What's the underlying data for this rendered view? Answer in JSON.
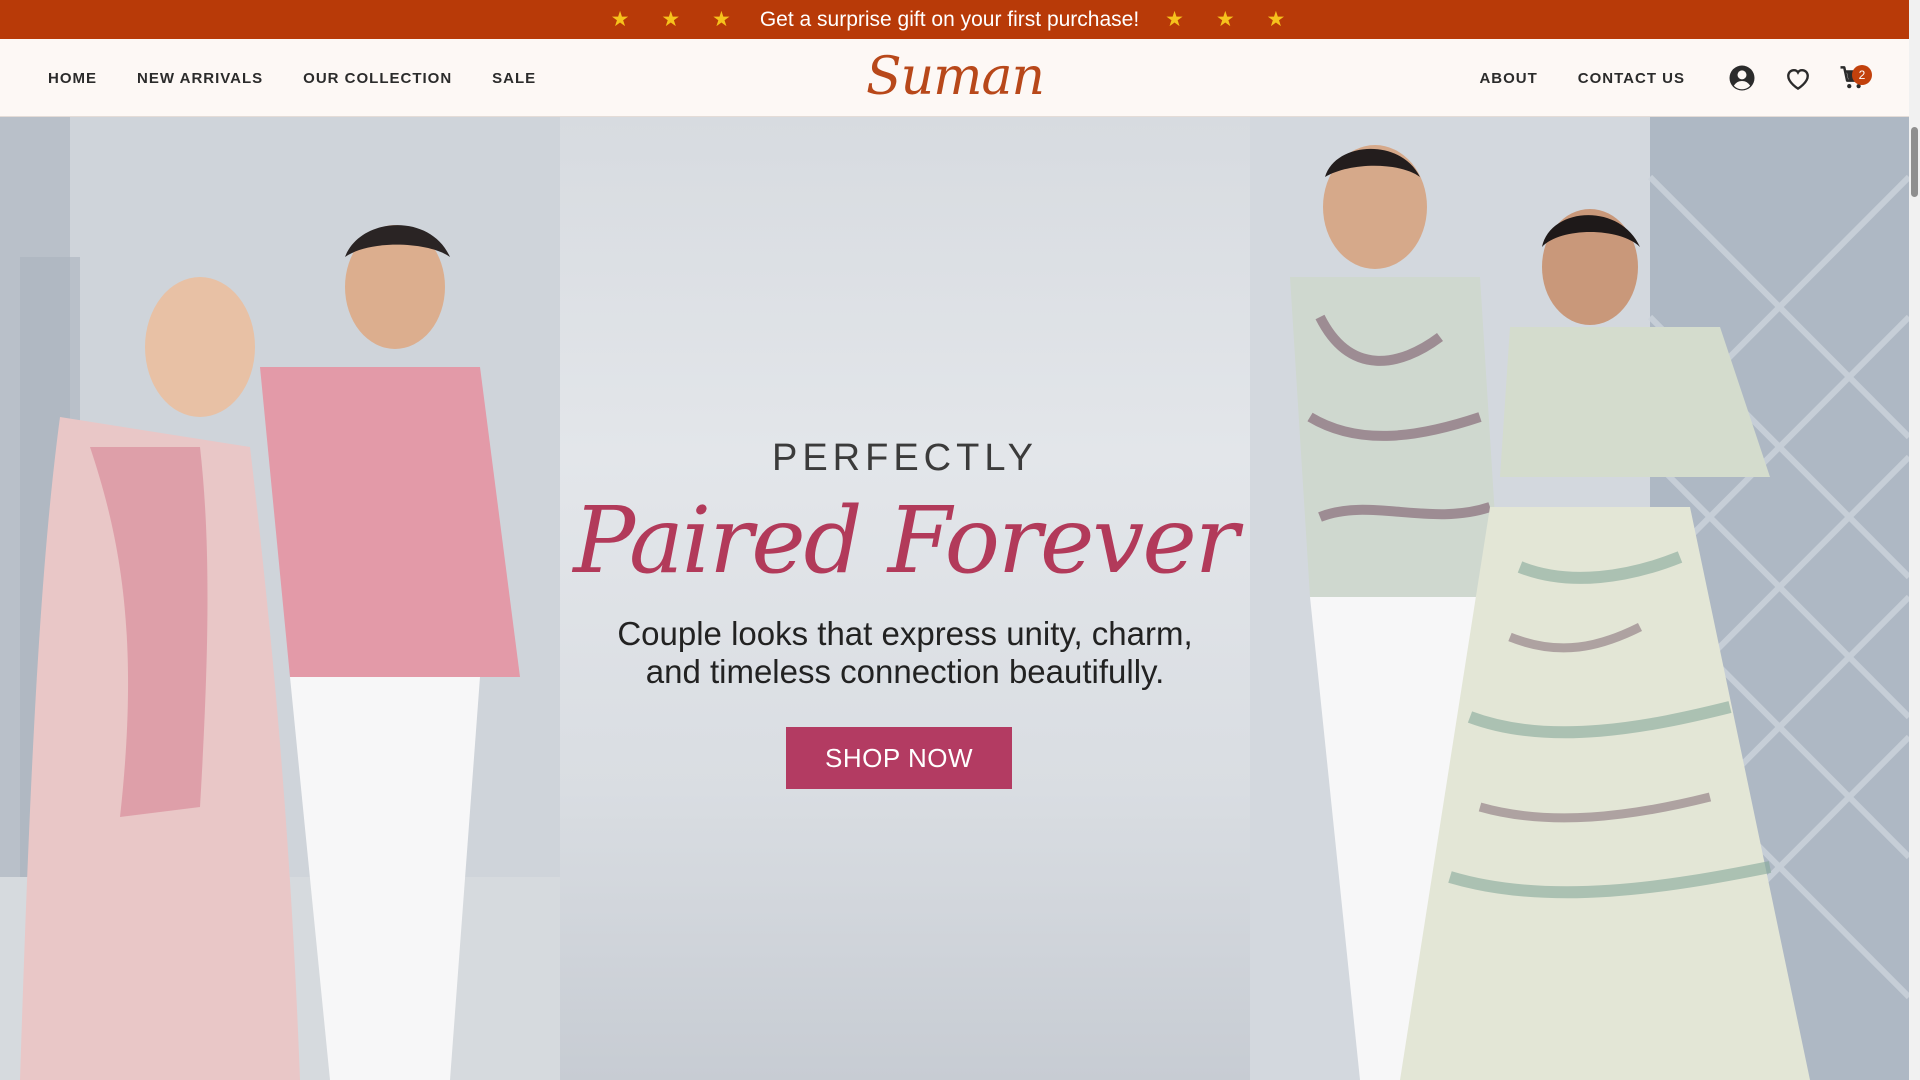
{
  "announcement": {
    "stars_left": "★ ★ ★",
    "message": "Get a surprise gift on your first purchase!",
    "stars_right": "★ ★ ★"
  },
  "nav_left": [
    "HOME",
    "NEW ARRIVALS",
    "OUR COLLECTION",
    "SALE"
  ],
  "logo": "Suman",
  "nav_right": [
    "ABOUT",
    "CONTACT US"
  ],
  "icons": {
    "account": "user-icon",
    "wishlist": "heart-icon",
    "cart": "cart-icon"
  },
  "cart": {
    "count": "2"
  },
  "hero": {
    "kicker": "PERFECTLY",
    "title": "Paired Forever",
    "subtitle_line1": "Couple looks that express unity, charm,",
    "subtitle_line2": "and timeless connection beautifully.",
    "cta": "SHOP NOW"
  },
  "colors": {
    "announcement_bg": "#b83a08",
    "star": "#f6c21c",
    "logo": "#b8481a",
    "title": "#b23a5a",
    "cta_bg": "#b33b62",
    "badge": "#c2410c"
  }
}
